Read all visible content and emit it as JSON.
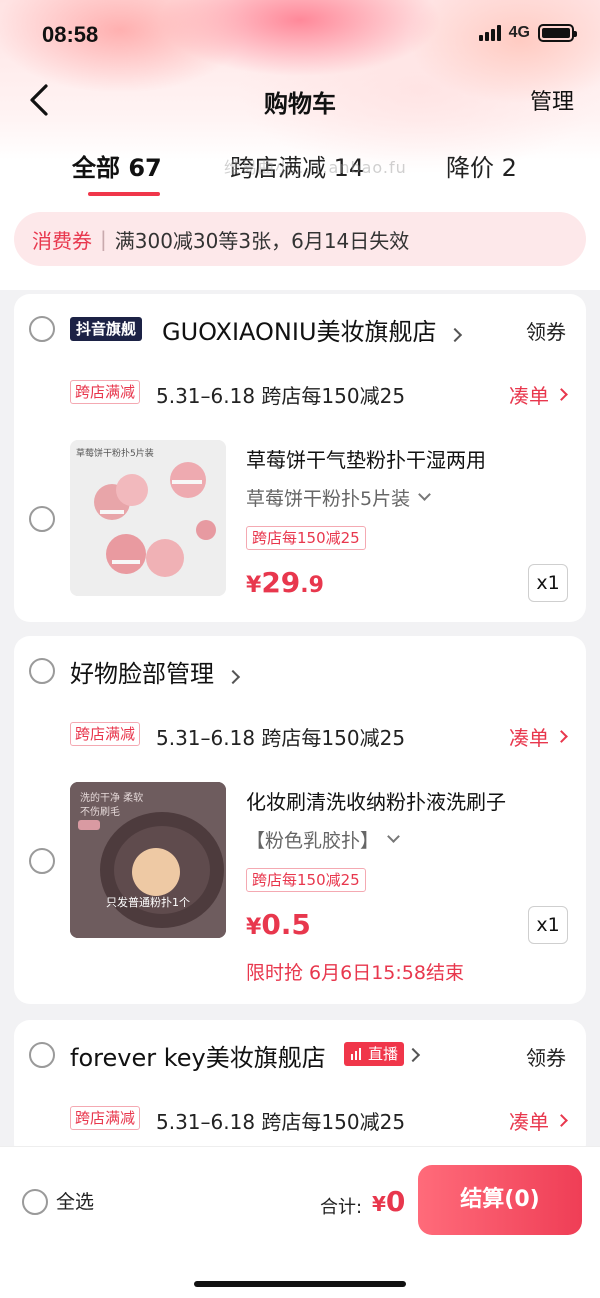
{
  "status_bar": {
    "time": "08:58",
    "network": "4G"
  },
  "nav": {
    "title": "购物车",
    "manage": "管理"
  },
  "tabs": [
    {
      "label": "全部 67",
      "active": true
    },
    {
      "label": "跨店满减 14",
      "active": false
    },
    {
      "label": "降价 2",
      "active": false
    }
  ],
  "watermark": "维易曲小... ..anbao.fu",
  "notice": {
    "tag": "消费券",
    "text": "满300减30等3张，6月14日失效"
  },
  "stores": [
    {
      "badge": "抖音旗舰",
      "name": "GUOXIAONIU美妆旗舰店",
      "coupon": "领券",
      "promo_tag": "跨店满减",
      "promo_text": "5.31–6.18 跨店每150减25",
      "addon": "凑单",
      "product": {
        "title": "草莓饼干气垫粉扑干湿两用",
        "spec": "草莓饼干粉扑5片装",
        "tag": "跨店每150减25",
        "price_currency": "¥",
        "price_int": "29",
        "price_dec": ".9",
        "qty": "x1",
        "thumb_text": "草莓饼干粉扑5片装"
      }
    },
    {
      "name": "好物脸部管理",
      "promo_tag": "跨店满减",
      "promo_text": "5.31–6.18 跨店每150减25",
      "addon": "凑单",
      "product": {
        "title": "化妆刷清洗收纳粉扑液洗刷子",
        "spec": "【粉色乳胶扑】",
        "tag": "跨店每150减25",
        "price_currency": "¥",
        "price_int": "0.5",
        "qty": "x1",
        "flash": "限时抢 6月6日15:58结束",
        "thumb_text": "只发普通粉扑1个",
        "thumb_note": "洗的干净 柔软不伤刷毛"
      }
    },
    {
      "name": "forever key美妆旗舰店",
      "live": "直播",
      "coupon": "领券",
      "promo_tag": "跨店满减",
      "promo_text": "5.31–6.18 跨店每150减25",
      "addon": "凑单"
    }
  ],
  "bottom": {
    "select_all": "全选",
    "total_label": "合计:",
    "total_currency": "¥",
    "total_value": "0",
    "checkout": "结算(0)"
  },
  "colors": {
    "accent": "#e8374d",
    "badge_dark": "#1c2245"
  }
}
